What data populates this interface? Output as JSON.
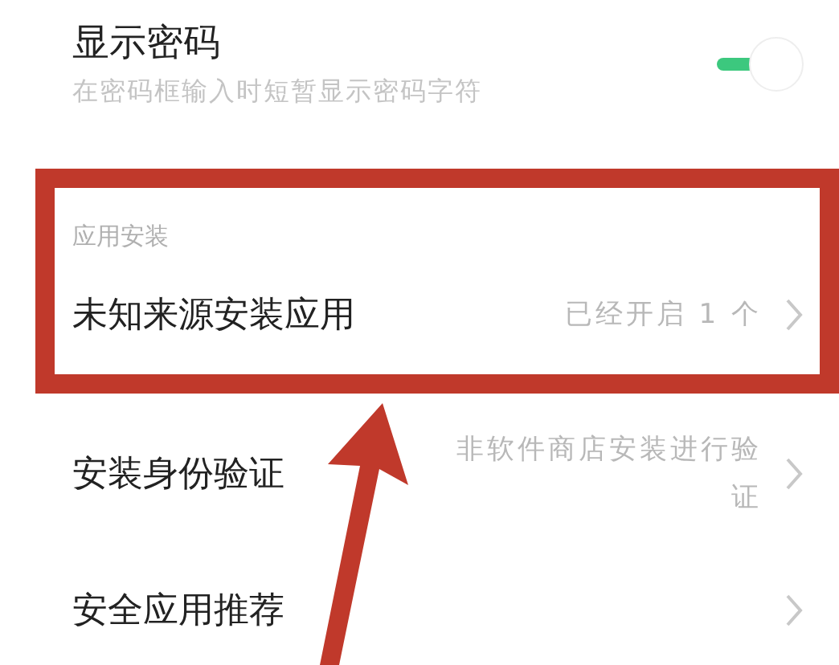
{
  "show_password": {
    "title": "显示密码",
    "subtitle": "在密码框输入时短暂显示密码字符",
    "on": true
  },
  "app_install": {
    "header": "应用安装",
    "highlighted": true,
    "items": [
      {
        "kind": "value",
        "label": "未知来源安装应用",
        "value": "已经开启 1 个"
      }
    ]
  },
  "items": [
    {
      "kind": "value",
      "label": "安装身份验证",
      "value": "非软件商店安装进行验证"
    },
    {
      "kind": "link",
      "label": "安全应用推荐"
    }
  ],
  "annotation": {
    "kind": "arrow"
  }
}
